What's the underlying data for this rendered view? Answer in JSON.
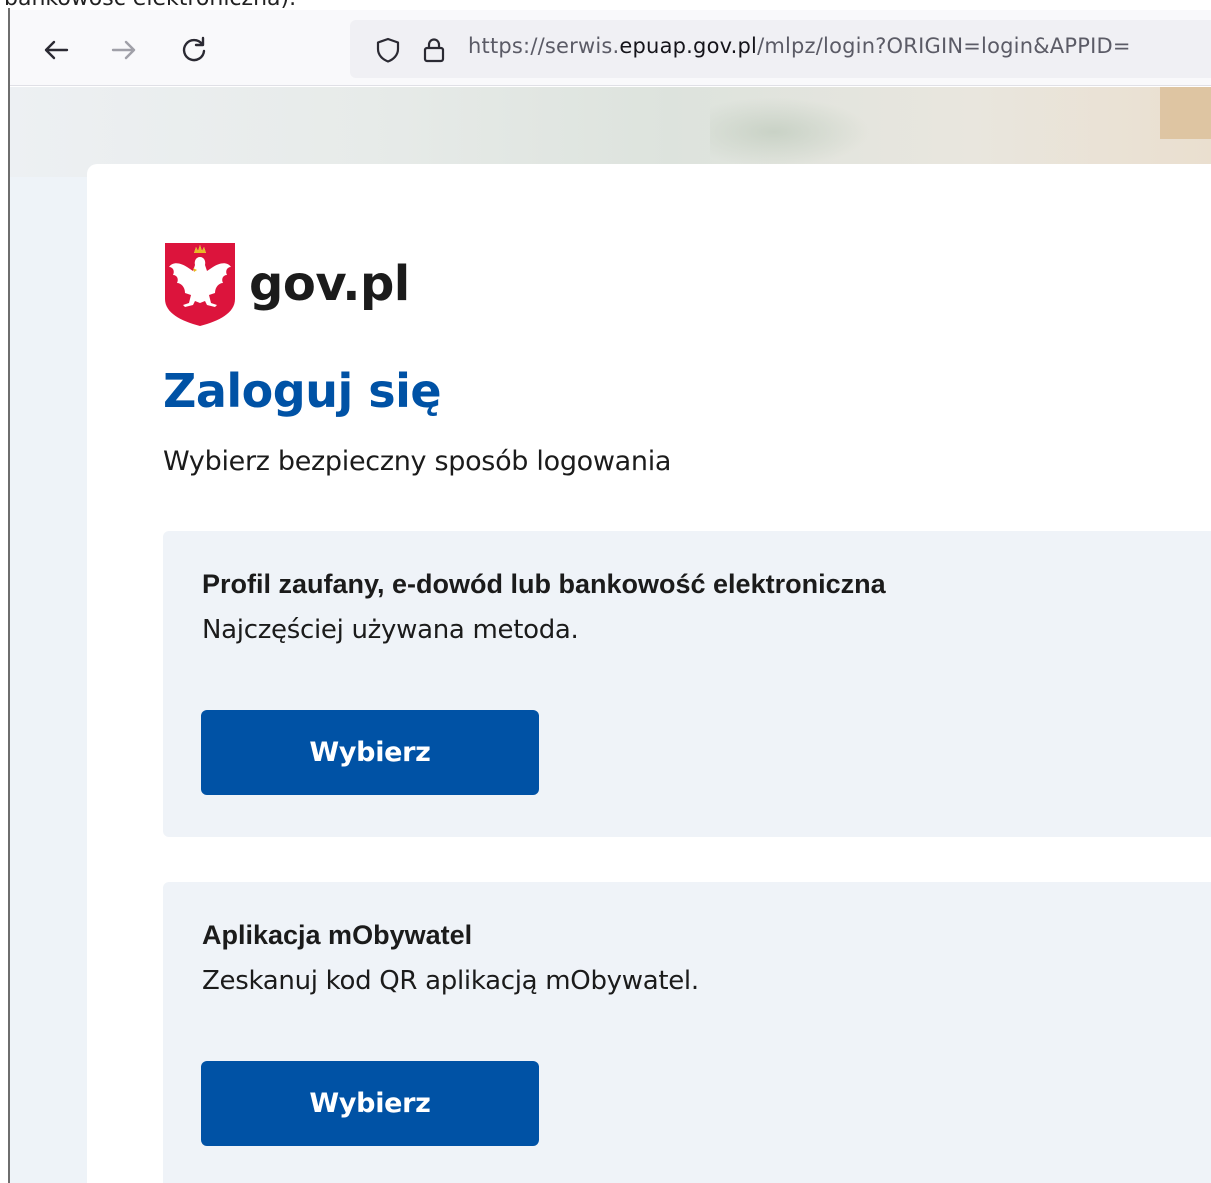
{
  "caption": "bankowość elektroniczna).",
  "browser": {
    "url_prefix": "https://serwis.",
    "url_host": "epuap.gov.pl",
    "url_rest": "/mlpz/login?ORIGIN=login&APPID=",
    "icons": [
      "back-arrow-icon",
      "forward-arrow-icon",
      "reload-icon",
      "shield-icon",
      "lock-icon"
    ]
  },
  "brand": {
    "logo_text": "gov.pl",
    "emblem_colors": {
      "shield": "#dc143c",
      "eagle": "#ffffff"
    }
  },
  "login": {
    "title": "Zaloguj się",
    "subtitle": "Wybierz bezpieczny sposób logowania",
    "options": [
      {
        "title": "Profil zaufany, e-dowód lub bankowość elektroniczna",
        "description": "Najczęściej używana metoda.",
        "button_label": "Wybierz"
      },
      {
        "title": "Aplikacja mObywatel",
        "description": "Zeskanuj kod QR aplikacją mObywatel.",
        "button_label": "Wybierz"
      }
    ]
  },
  "colors": {
    "accent": "#0052a5",
    "option_bg": "#eff3f8",
    "text": "#1b1b1b"
  }
}
